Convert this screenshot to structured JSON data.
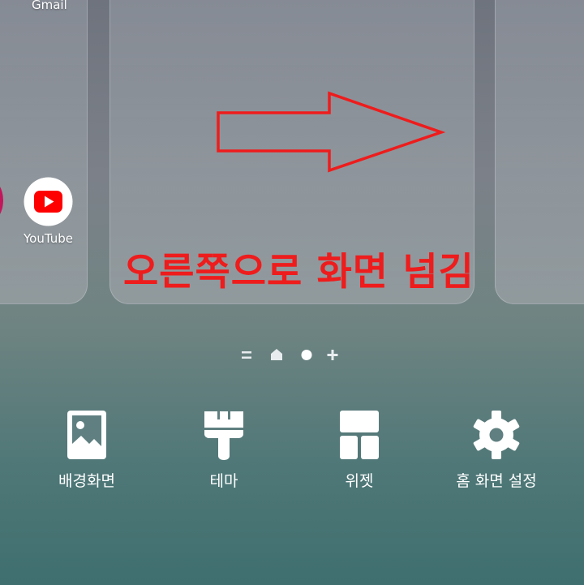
{
  "home_screen": {
    "apps": [
      {
        "label": "Gmail",
        "icon": "gmail-icon"
      },
      {
        "label": "YouTube",
        "icon": "youtube-icon"
      }
    ]
  },
  "annotation": {
    "caption": "오른쪽으로 화면 넘김",
    "caption_color": "#ee1c1c",
    "arrow_direction": "right",
    "arrow_icon": "right-arrow-icon"
  },
  "page_indicators": {
    "icons": [
      "menu-lines-icon",
      "home-page-icon",
      "current-page-dot-icon",
      "add-page-icon"
    ],
    "current_index": 2
  },
  "edit_actions": [
    {
      "label": "배경화면",
      "icon": "wallpaper-icon"
    },
    {
      "label": "테마",
      "icon": "theme-brush-icon"
    },
    {
      "label": "위젯",
      "icon": "widget-icon"
    },
    {
      "label": "홈 화면 설정",
      "icon": "gear-icon"
    }
  ],
  "colors": {
    "youtube_red": "#ff0000",
    "text": "#ffffff"
  }
}
